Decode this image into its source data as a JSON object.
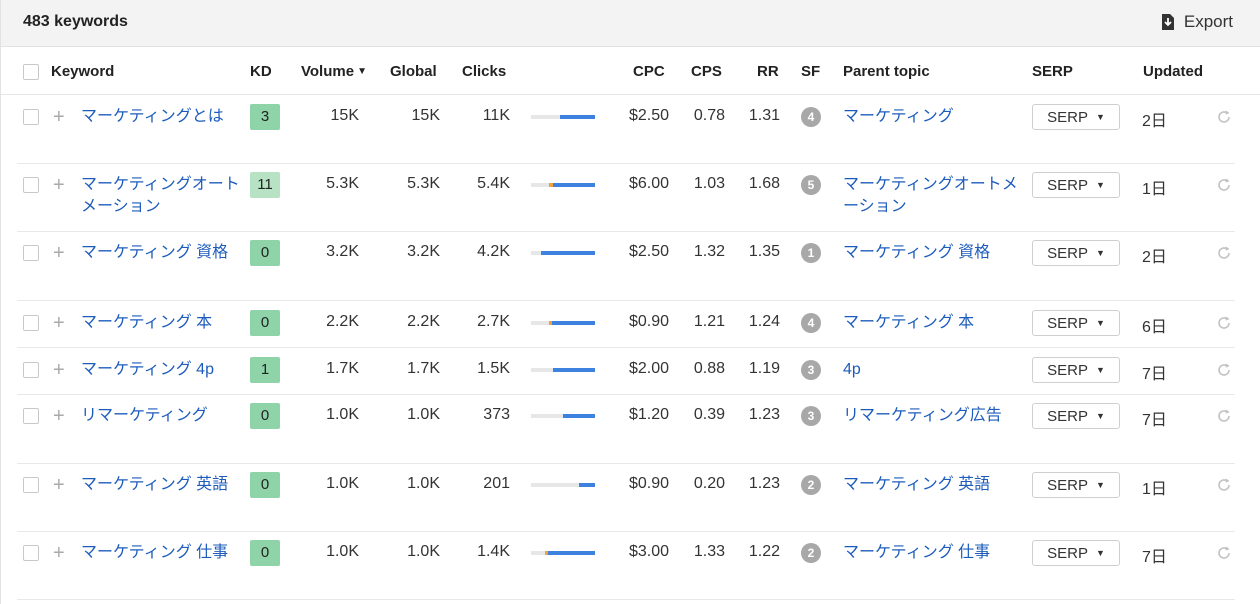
{
  "toolbar": {
    "keyword_count": "483 keywords",
    "export_label": "Export"
  },
  "table": {
    "headers": {
      "keyword": "Keyword",
      "kd": "KD",
      "volume": "Volume",
      "volume_sort_icon": "▼",
      "global": "Global",
      "clicks": "Clicks",
      "cpc": "CPC",
      "cps": "CPS",
      "rr": "RR",
      "sf": "SF",
      "parent_topic": "Parent topic",
      "serp": "SERP",
      "updated": "Updated"
    },
    "serp_button_label": "SERP",
    "serp_caret": "▼",
    "rows": [
      {
        "keyword": "マーケティングとは",
        "kd": "3",
        "volume": "15K",
        "global": "15K",
        "clicks": "11K",
        "cpc": "$2.50",
        "cps": "0.78",
        "rr": "1.31",
        "sf": "4",
        "parent_topic": "マーケティング",
        "updated": "2日",
        "clicks_paid": 0.0,
        "clicks_total_fraction": 0.55
      },
      {
        "keyword": "マーケティングオートメーション",
        "kd": "11",
        "volume": "5.3K",
        "global": "5.3K",
        "clicks": "5.4K",
        "cpc": "$6.00",
        "cps": "1.03",
        "rr": "1.68",
        "sf": "5",
        "parent_topic": "マーケティングオートメーション",
        "updated": "1日",
        "clicks_paid": 0.06,
        "clicks_total_fraction": 0.72
      },
      {
        "keyword": "マーケティング 資格",
        "kd": "0",
        "volume": "3.2K",
        "global": "3.2K",
        "clicks": "4.2K",
        "cpc": "$2.50",
        "cps": "1.32",
        "rr": "1.35",
        "sf": "1",
        "parent_topic": "マーケティング 資格",
        "updated": "2日",
        "clicks_paid": 0.0,
        "clicks_total_fraction": 0.85
      },
      {
        "keyword": "マーケティング 本",
        "kd": "0",
        "volume": "2.2K",
        "global": "2.2K",
        "clicks": "2.7K",
        "cpc": "$0.90",
        "cps": "1.21",
        "rr": "1.24",
        "sf": "4",
        "parent_topic": "マーケティング 本",
        "updated": "6日",
        "clicks_paid": 0.04,
        "clicks_total_fraction": 0.72
      },
      {
        "keyword": "マーケティング 4p",
        "kd": "1",
        "volume": "1.7K",
        "global": "1.7K",
        "clicks": "1.5K",
        "cpc": "$2.00",
        "cps": "0.88",
        "rr": "1.19",
        "sf": "3",
        "parent_topic": "4p",
        "updated": "7日",
        "clicks_paid": 0.0,
        "clicks_total_fraction": 0.66
      },
      {
        "keyword": "リマーケティング",
        "kd": "0",
        "volume": "1.0K",
        "global": "1.0K",
        "clicks": "373",
        "cpc": "$1.20",
        "cps": "0.39",
        "rr": "1.23",
        "sf": "3",
        "parent_topic": "リマーケティング広告",
        "updated": "7日",
        "clicks_paid": 0.0,
        "clicks_total_fraction": 0.5
      },
      {
        "keyword": "マーケティング 英語",
        "kd": "0",
        "volume": "1.0K",
        "global": "1.0K",
        "clicks": "201",
        "cpc": "$0.90",
        "cps": "0.20",
        "rr": "1.23",
        "sf": "2",
        "parent_topic": "マーケティング 英語",
        "updated": "1日",
        "clicks_paid": 0.0,
        "clicks_total_fraction": 0.25
      },
      {
        "keyword": "マーケティング 仕事",
        "kd": "0",
        "volume": "1.0K",
        "global": "1.0K",
        "clicks": "1.4K",
        "cpc": "$3.00",
        "cps": "1.33",
        "rr": "1.22",
        "sf": "2",
        "parent_topic": "マーケティング 仕事",
        "updated": "7日",
        "clicks_paid": 0.04,
        "clicks_total_fraction": 0.78
      }
    ]
  },
  "colors": {
    "link": "#1d5cbc",
    "kd_easy": "#8fd3a9",
    "kd_light": "#b7e3c4",
    "clicks_organic": "#3e82df",
    "clicks_paid": "#f1a33a",
    "sf_badge": "#a8a8a8"
  },
  "icons": {
    "export": "download-icon",
    "refresh": "refresh-icon",
    "add": "plus-icon"
  }
}
